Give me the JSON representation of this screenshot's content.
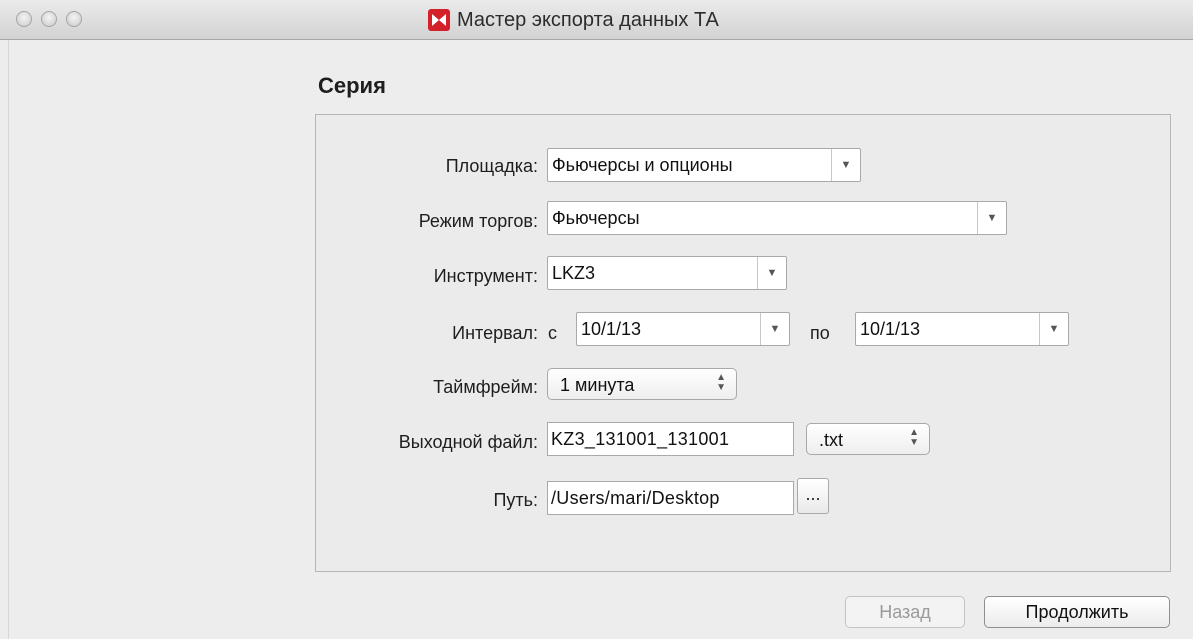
{
  "window": {
    "title": "Мастер экспорта данных ТА"
  },
  "section": {
    "title": "Серия"
  },
  "form": {
    "venue_label": "Площадка:",
    "venue_value": "Фьючерсы и опционы",
    "mode_label": "Режим торгов:",
    "mode_value": "Фьючерсы",
    "instrument_label": "Инструмент:",
    "instrument_value": "LKZ3",
    "interval_label": "Интервал:",
    "interval_from_prefix": "с",
    "interval_from_value": "10/1/13",
    "interval_to_prefix": "по",
    "interval_to_value": "10/1/13",
    "timeframe_label": "Таймфрейм:",
    "timeframe_value": "1 минута",
    "output_label": "Выходной файл:",
    "output_value": "KZ3_131001_131001",
    "extension_value": ".txt",
    "path_label": "Путь:",
    "path_value": "/Users/mari/Desktop",
    "browse_label": "..."
  },
  "buttons": {
    "back_label": "Назад",
    "next_label": "Продолжить"
  },
  "colors": {
    "app_icon": "#d4202a",
    "background": "#ececec"
  }
}
